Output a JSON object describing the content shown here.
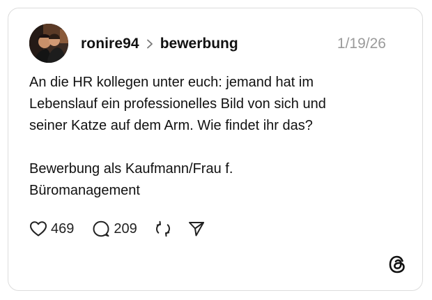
{
  "post": {
    "username": "ronire94",
    "community": "bewerbung",
    "date": "1/19/26",
    "body": "An die HR kollegen unter euch:  jemand hat im\nLebenslauf ein professionelles Bild von sich und\nseiner Katze auf dem Arm. Wie findet ihr das?\n\nBewerbung als Kaufmann/Frau f.\nBüromanagement",
    "likes": "469",
    "comments": "209"
  },
  "icons": {
    "avatar": "user-avatar-photo",
    "separator": "chevron-right-icon",
    "like": "heart-icon",
    "comment": "comment-bubble-icon",
    "repost": "repost-icon",
    "share": "send-icon",
    "brand": "threads-logo-icon"
  },
  "colors": {
    "text": "#111111",
    "muted": "#9a9a9a",
    "border": "#dcdcdc"
  }
}
